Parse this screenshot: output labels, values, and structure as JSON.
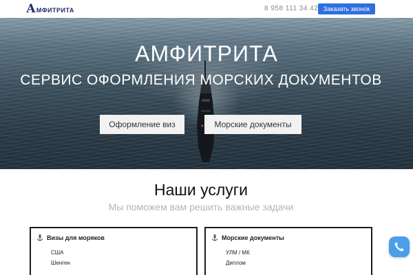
{
  "header": {
    "logo_initial": "А",
    "logo_rest": "МФИТРИТА",
    "phone": "8 958 111 34 42",
    "call_button": "Заказать звонок"
  },
  "hero": {
    "title": "АМФИТРИТА",
    "subtitle": "СЕРВИС ОФОРМЛЕНИЯ МОРСКИХ ДОКУМЕНТОВ",
    "buttons": [
      "Оформление виз",
      "Морские документы"
    ]
  },
  "services": {
    "title": "Наши услуги",
    "subtitle": "Мы поможем вам решить важные задачи",
    "cards": [
      {
        "icon": "anchor-icon",
        "title": "Визы для моряков",
        "items": [
          "США",
          "Шенген"
        ]
      },
      {
        "icon": "anchor-icon",
        "title": "Морские документы",
        "items": [
          "УЛМ / МК",
          "Диплом"
        ]
      }
    ]
  },
  "colors": {
    "brand": "#1f2a6b",
    "accent": "#2f6fe0",
    "chat": "#4aa0e8"
  },
  "chat_icon": "phone-icon"
}
